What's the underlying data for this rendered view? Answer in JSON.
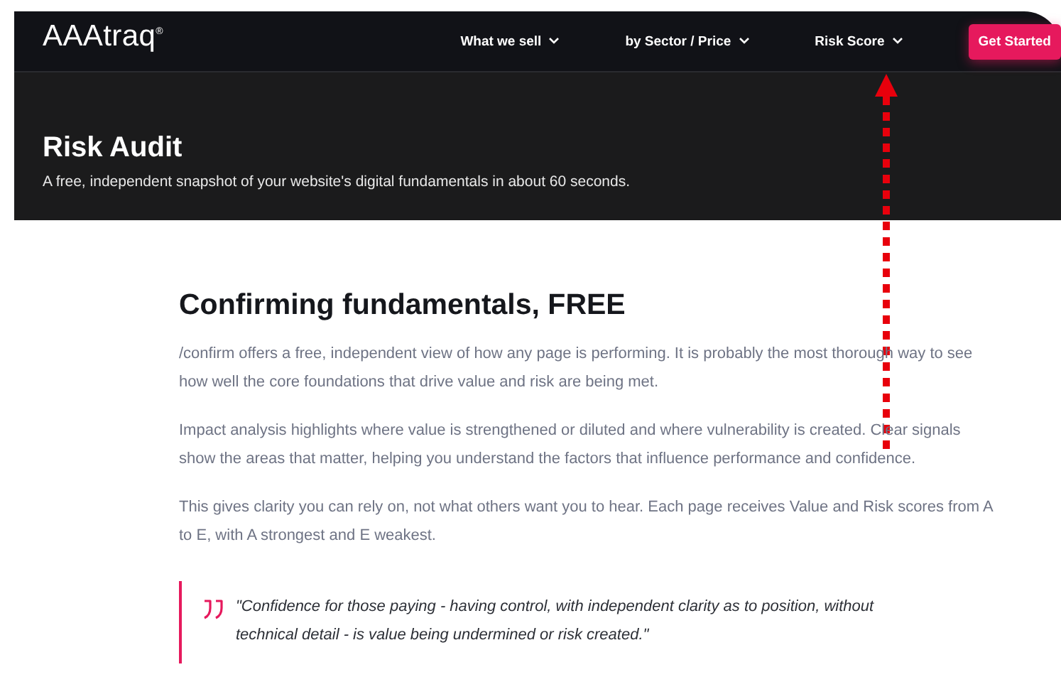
{
  "logo": "AAAtraq$^{®}$",
  "nav": {
    "items": [
      "What we sell",
      "by Sector / Price",
      "Risk Score"
    ],
    "cta": "Get Started"
  },
  "hero": {
    "title": "Risk Audit",
    "subtitle": "A free, independent snapshot of your website's digital fundamentals in about 60 seconds."
  },
  "article": {
    "heading": "Confirming fundamentals, FREE",
    "paragraphs": [
      "/confirm offers a free, independent view of how any page is performing. It is probably the most thorough way to see how well the core foundations that drive value and risk are being met.",
      "Impact analysis highlights where value is strengthened or diluted and where vulnerability is created. Clear signals show the areas that matter, helping you understand the factors that influence performance and confidence.",
      "This gives clarity you can rely on, not what others want you to hear. Each page receives Value and Risk scores from A to E, with A strongest and E weakest."
    ],
    "quote": "\"Confidence for those paying - having control, with independent clarity as to position, without technical detail - is value being undermined or risk created.\""
  }
}
